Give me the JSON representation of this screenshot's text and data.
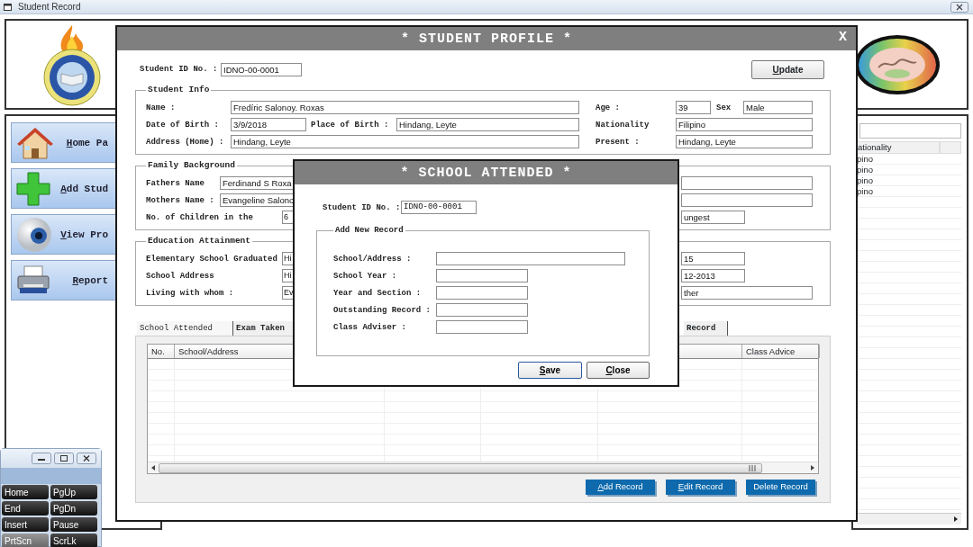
{
  "window": {
    "title": "Student Record"
  },
  "sidebar": {
    "items": [
      {
        "label": "Home Pa",
        "kind": "home"
      },
      {
        "label": "Add Stud",
        "kind": "add"
      },
      {
        "label": "View Pro",
        "kind": "view"
      },
      {
        "label": "Report",
        "kind": "report"
      }
    ]
  },
  "student_list": {
    "columns": [
      "ationality"
    ],
    "rows": [
      "pino",
      "pino",
      "pino",
      "pino"
    ]
  },
  "profile_dialog": {
    "title": "* STUDENT PROFILE *",
    "close_label": "X",
    "student_id_label": "Student ID No. :",
    "student_id": "IDNO-00-0001",
    "update_button": "Update",
    "sections": [
      {
        "legend": "Student Info",
        "rows": [
          {
            "left": [
              {
                "label": "Name :",
                "value": "Fredíric Salonoy. Roxas"
              }
            ],
            "right": [
              {
                "label": "Age :",
                "value": "39"
              },
              {
                "label": "Sex",
                "value": "Male"
              }
            ]
          },
          {
            "left": [
              {
                "label": "Date of Birth :",
                "value": "3/9/2018"
              },
              {
                "label": "Place of Birth :",
                "value": "Hindang, Leyte"
              }
            ],
            "right": [
              {
                "label": "Nationality",
                "value": "Filipino"
              }
            ]
          },
          {
            "left": [
              {
                "label": "Address (Home) :",
                "value": "Hindang, Leyte"
              }
            ],
            "right": [
              {
                "label": "Present :",
                "value": "Hindang, Leyte"
              }
            ]
          }
        ]
      },
      {
        "legend": "Family Background",
        "rows": [
          {
            "left": [
              {
                "label": "Fathers Name",
                "value": "Ferdinand S Roxa"
              }
            ],
            "right": [
              {
                "kind": "field"
              }
            ]
          },
          {
            "left": [
              {
                "label": "Mothers Name :",
                "value": "Evangeline Salono"
              }
            ],
            "right": [
              {
                "kind": "field"
              }
            ]
          },
          {
            "left": [
              {
                "label": "No. of Children in the",
                "value": "6"
              }
            ],
            "right": [
              {
                "value": "ungest"
              }
            ]
          }
        ]
      },
      {
        "legend": "Education Attainment",
        "rows": [
          {
            "left": [
              {
                "label": "Elementary School Graduated",
                "value": "Hi"
              }
            ],
            "right": [
              {
                "value": "15"
              }
            ]
          },
          {
            "left": [
              {
                "label": "School Address",
                "value": "Hi"
              }
            ],
            "right": [
              {
                "value": "12-2013"
              }
            ]
          },
          {
            "left": [
              {
                "label": "Living with whom :",
                "value": "Ev"
              }
            ],
            "right": [
              {
                "value": "ther"
              }
            ]
          }
        ]
      }
    ],
    "tabs": [
      {
        "label": "School Attended",
        "selected": true
      },
      {
        "label": "Exam Taken",
        "selected": false
      },
      {
        "label": "Record",
        "selected": false
      }
    ],
    "grid": {
      "columns": [
        "No.",
        "School/Address",
        "Class Advice"
      ]
    },
    "buttons": [
      "Add Record",
      "Edit Record",
      "Delete Record"
    ]
  },
  "school_dialog": {
    "title": "* SCHOOL ATTENDED *",
    "student_id_label": "Student ID No. :",
    "student_id": "IDNO-00-0001",
    "legend": "Add New Record",
    "fields": [
      {
        "label": "School/Address :"
      },
      {
        "label": "School Year :"
      },
      {
        "label": "Year and Section :"
      },
      {
        "label": "Outstanding Record :"
      },
      {
        "label": "Class Adviser :"
      }
    ],
    "buttons": [
      "Save",
      "Close"
    ]
  },
  "keyboard": {
    "keys": [
      {
        "label": "Home",
        "highlighted": false
      },
      {
        "label": "PgUp",
        "highlighted": false
      },
      {
        "label": "End",
        "highlighted": false
      },
      {
        "label": "PgDn",
        "highlighted": false
      },
      {
        "label": "Insert",
        "highlighted": false
      },
      {
        "label": "Pause",
        "highlighted": false
      },
      {
        "label": "PrtScn",
        "highlighted": true
      },
      {
        "label": "ScrLk",
        "highlighted": false
      }
    ]
  }
}
